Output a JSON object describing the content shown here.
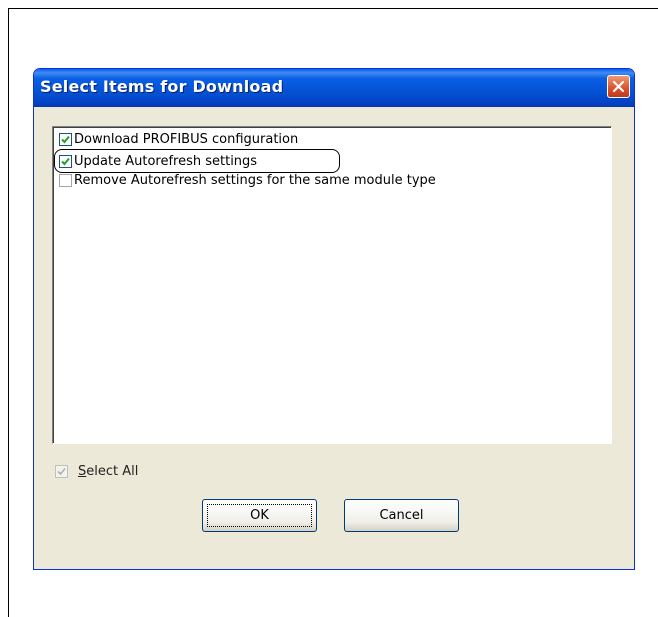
{
  "dialog": {
    "title": "Select Items for Download",
    "close_icon": "close-icon"
  },
  "items": [
    {
      "label": "Download PROFIBUS configuration",
      "checked": true
    },
    {
      "label": "Update Autorefresh settings",
      "checked": true
    },
    {
      "label": "Remove Autorefresh settings for the same module type",
      "checked": false
    }
  ],
  "select_all": {
    "label_underlined": "S",
    "label_rest": "elect All",
    "checked": true,
    "disabled": true
  },
  "buttons": {
    "ok": "OK",
    "cancel": "Cancel"
  },
  "colors": {
    "titlebar": "#0452d4",
    "client_bg": "#ece9d8",
    "close_button": "#d8512a"
  }
}
